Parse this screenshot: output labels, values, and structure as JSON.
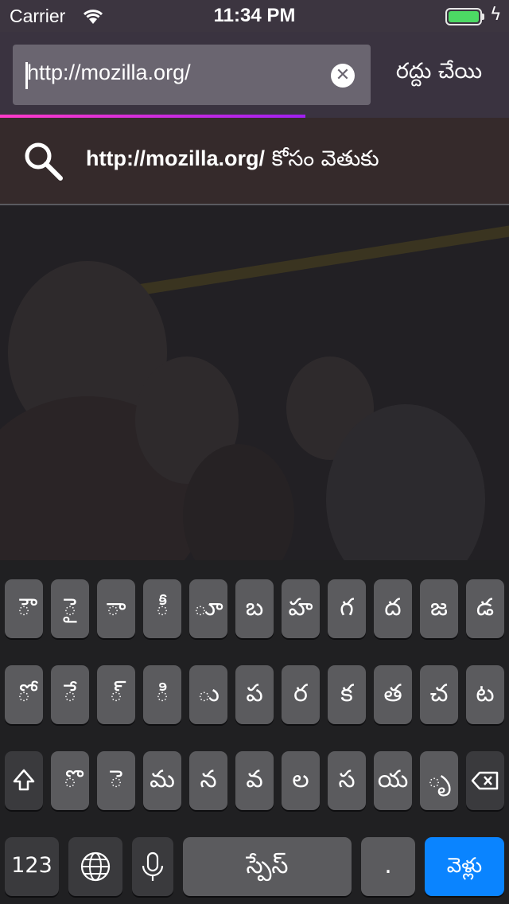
{
  "status_bar": {
    "carrier": "Carrier",
    "time": "11:34 PM"
  },
  "url_bar": {
    "value": "http://mozilla.org/",
    "cancel_label": "రద్దు చేయి"
  },
  "suggestion": {
    "query": "http://mozilla.org/",
    "suffix": " కోసం వెతుకు"
  },
  "load_progress_percent": 60,
  "keyboard": {
    "row1": [
      "ౌ",
      "ై",
      "ా",
      "ీ",
      "ూ",
      "బ",
      "హ",
      "గ",
      "ద",
      "జ",
      "డ"
    ],
    "row2": [
      "ో",
      "ే",
      "్",
      "ి",
      "ు",
      "ప",
      "ర",
      "క",
      "త",
      "చ",
      "ట"
    ],
    "row3": [
      "ొ",
      "ె",
      "మ",
      "న",
      "వ",
      "ల",
      "స",
      "య",
      "ృ"
    ],
    "numbers_label": "123",
    "space_label": "స్పేస్",
    "period_label": ".",
    "go_label": "వెళ్లు"
  }
}
